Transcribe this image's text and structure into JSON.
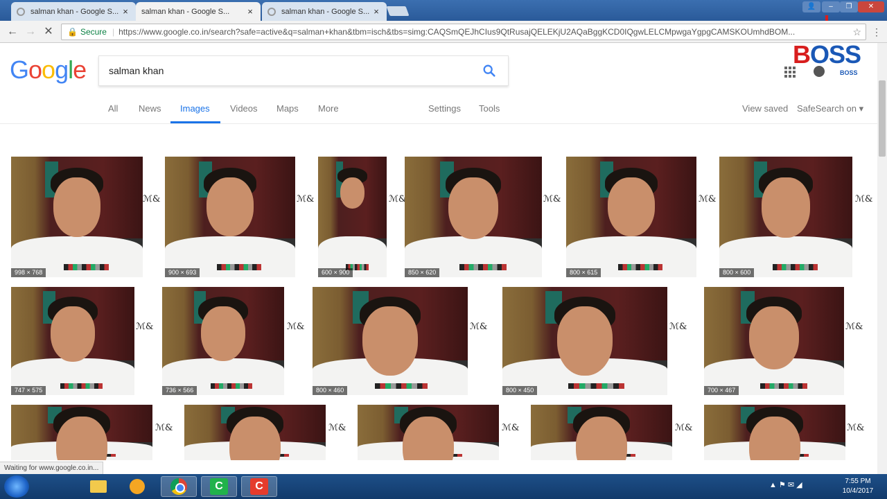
{
  "browser": {
    "tabs": [
      {
        "title": "salman khan - Google S...",
        "active": false
      },
      {
        "title": "salman khan - Google S...",
        "active": true
      },
      {
        "title": "salman khan - Google S...",
        "active": false
      }
    ],
    "close_glyph": "×",
    "secure_label": "Secure",
    "url": "https://www.google.co.in/search?safe=active&q=salman+khan&tbm=isch&tbs=simg:CAQSmQEJhCIus9QtRusajQELEKjU2AQaBggKCD0IQgwLELCMpwgaYgpgCAMSKOUmhdBOM..."
  },
  "google": {
    "logo_letters": [
      {
        "ch": "G",
        "color": "#4285F4"
      },
      {
        "ch": "o",
        "color": "#EA4335"
      },
      {
        "ch": "o",
        "color": "#FBBC05"
      },
      {
        "ch": "g",
        "color": "#4285F4"
      },
      {
        "ch": "l",
        "color": "#34A853"
      },
      {
        "ch": "e",
        "color": "#EA4335"
      }
    ],
    "search_query": "salman khan",
    "nav": [
      "All",
      "News",
      "Images",
      "Videos",
      "Maps",
      "More",
      "Settings",
      "Tools"
    ],
    "active_nav": "Images",
    "right_nav": {
      "view_saved": "View saved",
      "safesearch": "SafeSearch on ▾"
    },
    "accent": "#1A73E8"
  },
  "watermark": {
    "brand_first": "B",
    "brand_rest": "OSS",
    "sub": "BOSS"
  },
  "results": {
    "rows": [
      [
        {
          "dim": "998 × 768"
        },
        {
          "dim": "900 × 693"
        },
        {
          "dim": "600 × 900"
        },
        {
          "dim": "850 × 620"
        },
        {
          "dim": "800 × 615"
        },
        {
          "dim": "800 × 600"
        }
      ],
      [
        {
          "dim": "747 × 575"
        },
        {
          "dim": "736 × 566"
        },
        {
          "dim": "800 × 460"
        },
        {
          "dim": "800 × 450"
        },
        {
          "dim": "700 × 467"
        }
      ],
      [
        {
          "dim": ""
        },
        {
          "dim": ""
        },
        {
          "dim": ""
        },
        {
          "dim": ""
        },
        {
          "dim": ""
        }
      ]
    ],
    "signature_glyph": "ℳ&"
  },
  "status": {
    "text": "Waiting for www.google.co.in..."
  },
  "taskbar": {
    "camtasia_glyph": "C",
    "clock_time": "7:55 PM",
    "clock_date": "10/4/2017",
    "tray_glyphs": "▲ ⚑ ✉ ◢"
  }
}
